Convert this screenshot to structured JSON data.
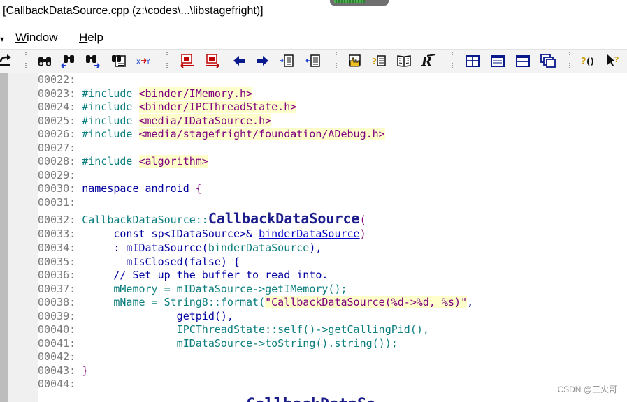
{
  "window": {
    "title": "[CallbackDataSource.cpp (z:\\codes\\...\\libstagefright)]"
  },
  "menu": {
    "window_u": "W",
    "window_rest": "indow",
    "help_u": "H",
    "help_rest": "elp"
  },
  "toolbar": {
    "buttons": [
      "binoculars-icon",
      "binoculars-back-icon",
      "binoculars-forward-icon",
      "binoculars-file-icon",
      "replace-icon",
      "bookmark-prev-icon",
      "bookmark-next-icon",
      "arrow-left-icon",
      "arrow-right-icon",
      "jump-back-icon",
      "jump-forward-icon",
      "hand-pointer-icon",
      "question-list-icon",
      "book-icon",
      "query-icon",
      "window-tile-icon",
      "window-single-icon",
      "window-split-icon",
      "window-cascade-icon",
      "context-help-icon",
      "whats-this-icon"
    ]
  },
  "code": {
    "ln22": "00022:",
    "ln23": "00023:",
    "ln24": "00024:",
    "ln25": "00025:",
    "ln26": "00026:",
    "ln27": "00027:",
    "ln28": "00028:",
    "ln29": "00029:",
    "ln30": "00030:",
    "ln31": "00031:",
    "ln32": "00032:",
    "ln33": "00033:",
    "ln34": "00034:",
    "ln35": "00035:",
    "ln36": "00036:",
    "ln37": "00037:",
    "ln38": "00038:",
    "ln39": "00039:",
    "ln40": "00040:",
    "ln41": "00041:",
    "ln42": "00042:",
    "ln43": "00043:",
    "ln44": "00044:",
    "include": "#include",
    "inc1": "<binder/IMemory.h>",
    "inc2": "<binder/IPCThreadState.h>",
    "inc3": "<media/IDataSource.h>",
    "inc4": "<media/stagefright/foundation/ADebug.h>",
    "inc5": "<algorithm>",
    "ns_kw": "namespace",
    "ns_name": "android",
    "ns_brace": "{",
    "ctor_class": "CallbackDataSource::",
    "ctor_name": "CallbackDataSource",
    "ctor_paren": "(",
    "l33_indent": "     ",
    "l33_const": "const",
    "l33_sp": " sp<IDataSource>& ",
    "l33_param": "binderDataSource",
    "l33_close": ")",
    "l34_text": "     : mIDataSource(",
    "l34_arg": "binderDataSource",
    "l34_end": "),",
    "l35_text": "       mIsClosed(false) {",
    "l36_comment": "     // Set up the buffer to read into.",
    "l37_text": "     mMemory = mIDataSource->getIMemory();",
    "l38_text": "     mName = String8::format(",
    "l38_str": "\"CallbackDataSource(%d->%d, %s)\"",
    "l38_end": ",",
    "l39_text": "               getpid(),",
    "l40_text": "               IPCThreadState::self()->getCallingPid(),",
    "l41_text": "               mIDataSource->toString().string());",
    "l43_brace": "}",
    "cut_off_text": "CallbackDataSo"
  },
  "watermark": "CSDN @三火哥"
}
